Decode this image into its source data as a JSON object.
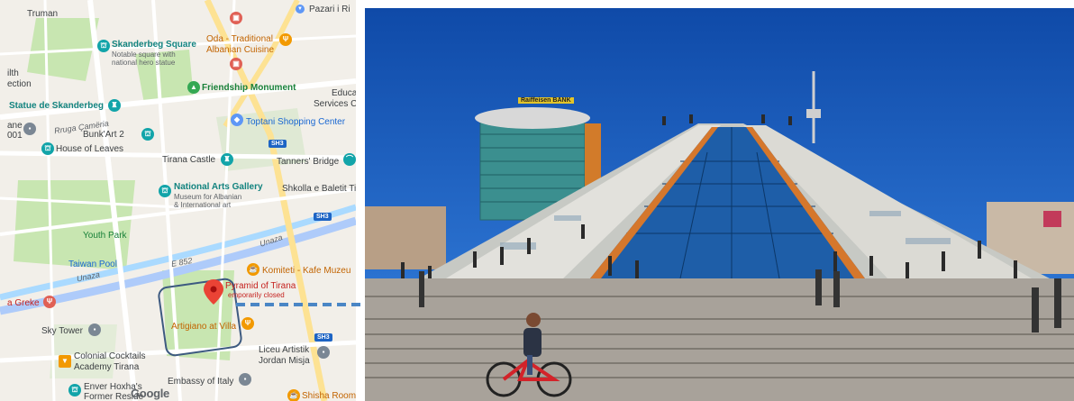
{
  "map": {
    "labels": {
      "truman": "Truman",
      "skanderbeg_square": "Skanderbeg Square",
      "skanderbeg_square_sub1": "Notable square with",
      "skanderbeg_square_sub2": "national hero statue",
      "oda_line1": "Oda - Traditional",
      "oda_line2": "Albanian Cuisine",
      "pazari": "Pazari i Ri",
      "ilth": "ilth",
      "ection": "ection",
      "friendship_monument": "Friendship Monument",
      "educa": "Educa",
      "services": "Services C",
      "statue_skanderbeg": "Statue de Skanderbeg",
      "rruga_cameria": "Rruga Çamëria",
      "toptani": "Toptani Shopping Center",
      "bunkart": "Bunk'Art 2",
      "ane": "ane",
      "n001": "001",
      "house_of_leaves": "House of Leaves",
      "tirana_castle": "Tirana Castle",
      "tanners_bridge": "Tanners' Bridge",
      "national_arts_gallery": "National Arts Gallery",
      "nag_sub1": "Museum for Albanian",
      "nag_sub2": "& International art",
      "shkolla": "Shkolla e Baletit Tira",
      "youth_park": "Youth Park",
      "unaza_1": "Unaza",
      "taiwan_pool": "Taiwan Pool",
      "e852": "E 852",
      "unaza_2": "Unaza",
      "komiteti": "Komiteti - Kafe Muzeu",
      "pyramid": "Pyramid of Tirana",
      "pyramid_sub": "emporarily closed",
      "greke": "a Greke",
      "sky_tower": "Sky Tower",
      "artigiano": "Artigiano at Villa",
      "liceu_line1": "Liceu Artistik",
      "liceu_line2": "Jordan Misja",
      "colonial_line1": "Colonial Cocktails",
      "colonial_line2": "Academy Tirana",
      "embassy_italy": "Embassy of Italy",
      "enver_line1": "Enver Hoxha's",
      "enver_line2": "Former Reside",
      "shisha": "Shisha Room",
      "sh3_a": "SH3",
      "sh3_b": "SH3",
      "sh3_c": "SH3",
      "google_logo": "Google"
    },
    "colors": {
      "land": "#f2efe9",
      "park": "#c8e6b1",
      "road_major": "#aecbfa",
      "road_minor": "#ffffff",
      "highlight_box": "#3d5a80",
      "arrow": "#4a86c5",
      "pin_red": "#ea4335"
    }
  },
  "photo": {
    "bank_sign": "Raiffeisen BANK",
    "colors": {
      "sky": "#1454b5",
      "ground": "#a8a29a"
    }
  }
}
